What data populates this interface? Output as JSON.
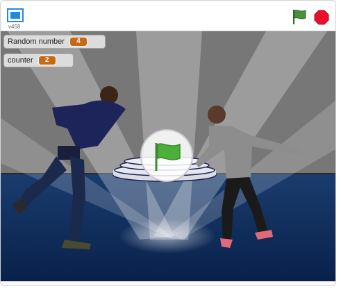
{
  "player": {
    "version_label": "v458",
    "icons": {
      "fullscreen": "fullscreen-icon",
      "green_flag": "green-flag-icon",
      "stop": "stop-sign-icon"
    }
  },
  "monitors": [
    {
      "label": "Random number",
      "value": "4"
    },
    {
      "label": "counter",
      "value": "2"
    }
  ],
  "colors": {
    "wall": "#7b7b7b",
    "floor": "#0d2b57",
    "flag_green": "#4caf3a",
    "stop_red": "#e8102a",
    "monitor_value": "#c86a14"
  }
}
